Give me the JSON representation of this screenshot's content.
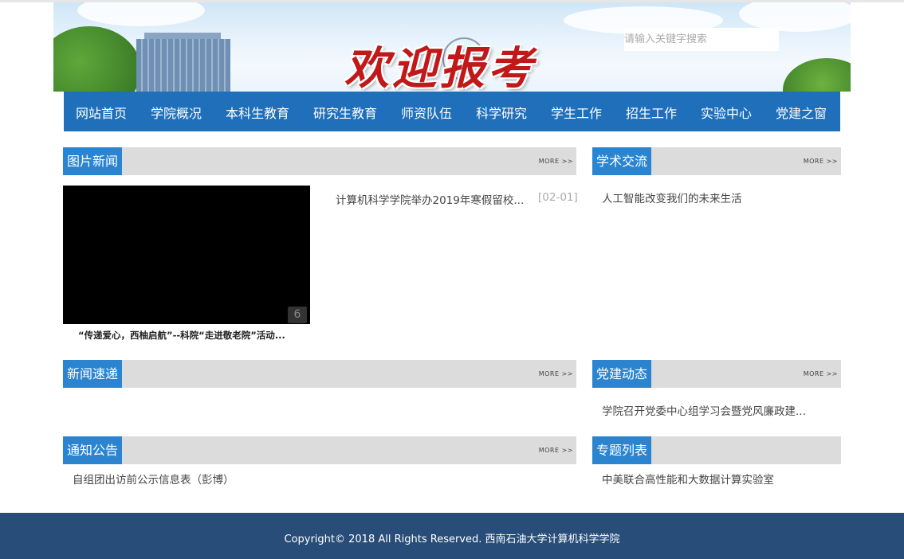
{
  "banner": {
    "welcome_text": "欢迎报考",
    "search_placeholder": "请输入关键字搜索"
  },
  "nav": {
    "items": [
      "网站首页",
      "学院概况",
      "本科生教育",
      "研究生教育",
      "师资队伍",
      "科学研究",
      "学生工作",
      "招生工作",
      "实验中心",
      "党建之窗"
    ]
  },
  "more_label": "MORE >>",
  "photo_news": {
    "title": "图片新闻",
    "video_badge": "6",
    "caption": "“传递爱心，西柚启航”--科院“走进敬老院”活动...",
    "list": [
      {
        "text": "计算机科学学院举办2019年寒假留校...",
        "date": "[02-01]"
      }
    ]
  },
  "academic": {
    "title": "学术交流",
    "list": [
      "人工智能改变我们的未来生活"
    ]
  },
  "news_express": {
    "title": "新闻速递",
    "list": []
  },
  "party_news": {
    "title": "党建动态",
    "list": [
      "学院召开党委中心组学习会暨党风廉政建..."
    ]
  },
  "notices": {
    "title": "通知公告",
    "list": [
      "自组团出访前公示信息表（彭博）"
    ]
  },
  "topics": {
    "title": "专题列表",
    "list": [
      "中美联合高性能和大数据计算实验室"
    ]
  },
  "footer": {
    "copyright": "Copyright© 2018 All Rights Reserved. 西南石油大学计算机科学学院"
  },
  "colors": {
    "nav_bg": "#1f6fba",
    "panel_title_bg": "#2a84d0",
    "panel_head_bg": "#dcdcdc",
    "footer_bg": "#274d78",
    "welcome": "#c0191a"
  }
}
